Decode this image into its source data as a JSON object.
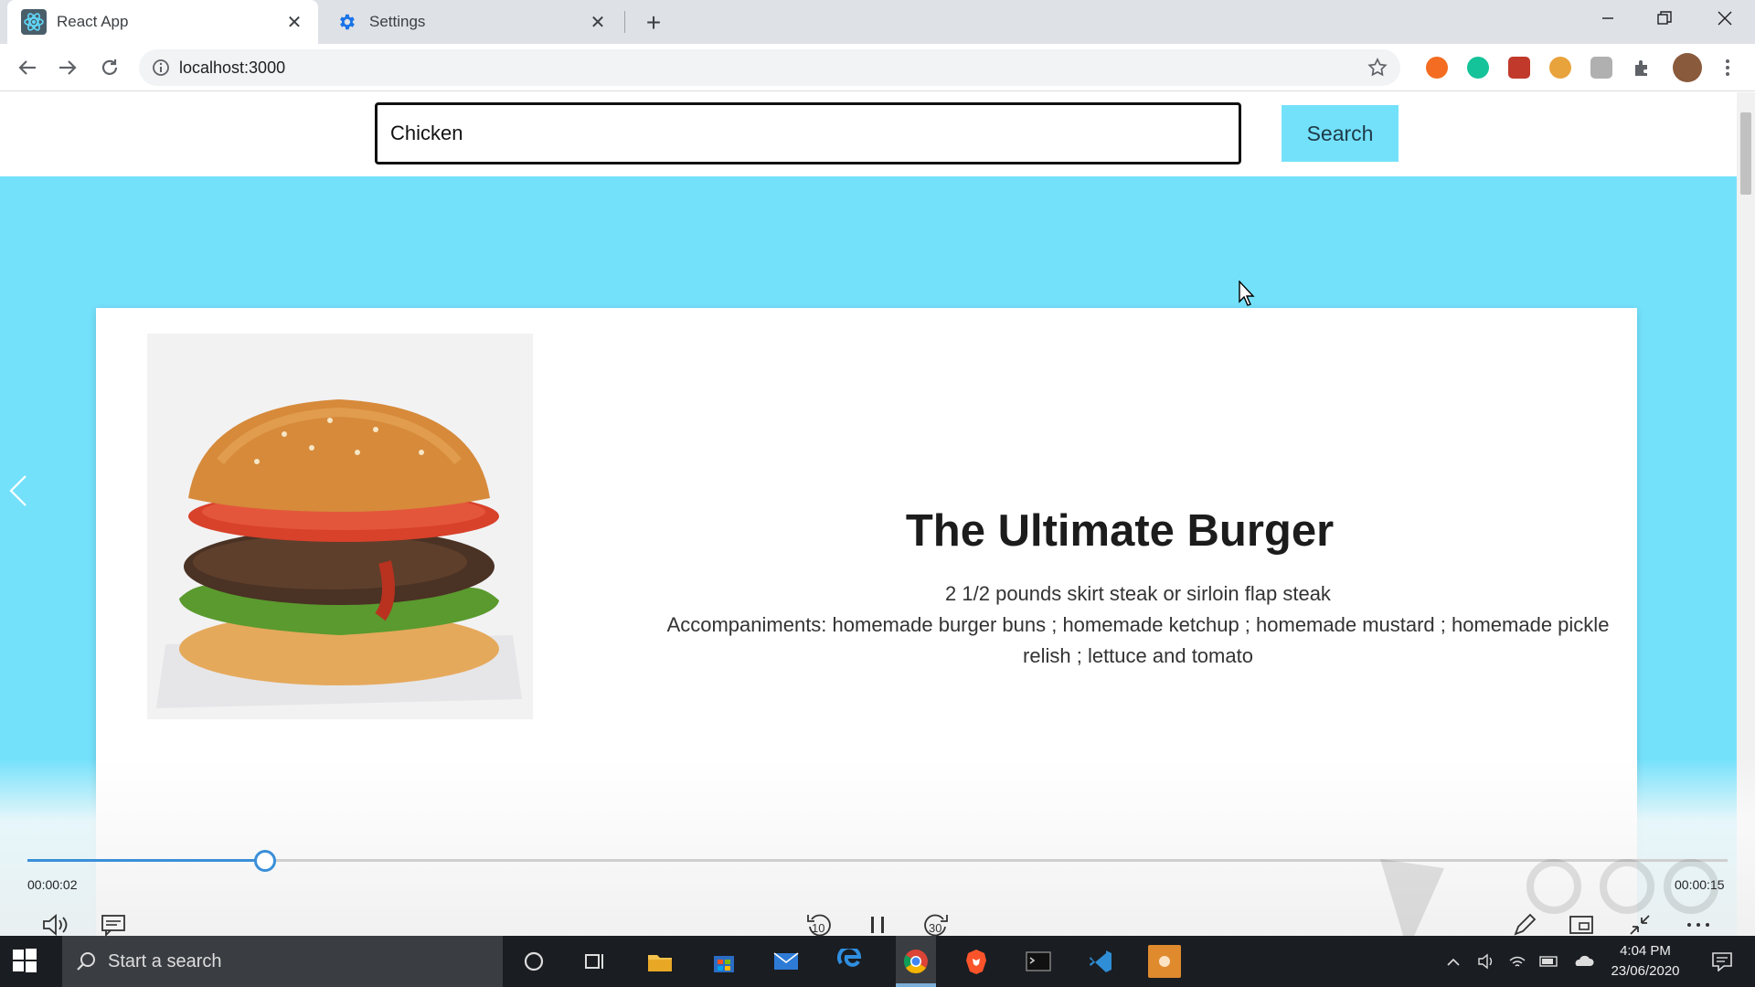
{
  "browser": {
    "tabs": [
      {
        "label": "React App",
        "active": true
      },
      {
        "label": "Settings",
        "active": false
      }
    ],
    "url": "localhost:3000"
  },
  "search": {
    "value": "Chicken",
    "placeholder": "",
    "button_label": "Search"
  },
  "recipe": {
    "title": "The Ultimate Burger",
    "ingredients": [
      "2 1/2 pounds skirt steak or sirloin flap steak",
      "Accompaniments: homemade burger buns ; homemade ketchup ; homemade mustard ; homemade pickle relish ; lettuce and tomato"
    ],
    "image_icon": "burger-image"
  },
  "video_player": {
    "current_time": "00:00:02",
    "total_time": "00:00:15",
    "progress": 0.14,
    "rewind_label": "10",
    "forward_label": "30"
  },
  "taskbar": {
    "search_placeholder": "Start a search",
    "time": "4:04 PM",
    "date": "23/06/2020"
  },
  "colors": {
    "page_background": "#74e1fb",
    "search_button": "#74e1fb",
    "progress_accent": "#3a8fd8"
  }
}
